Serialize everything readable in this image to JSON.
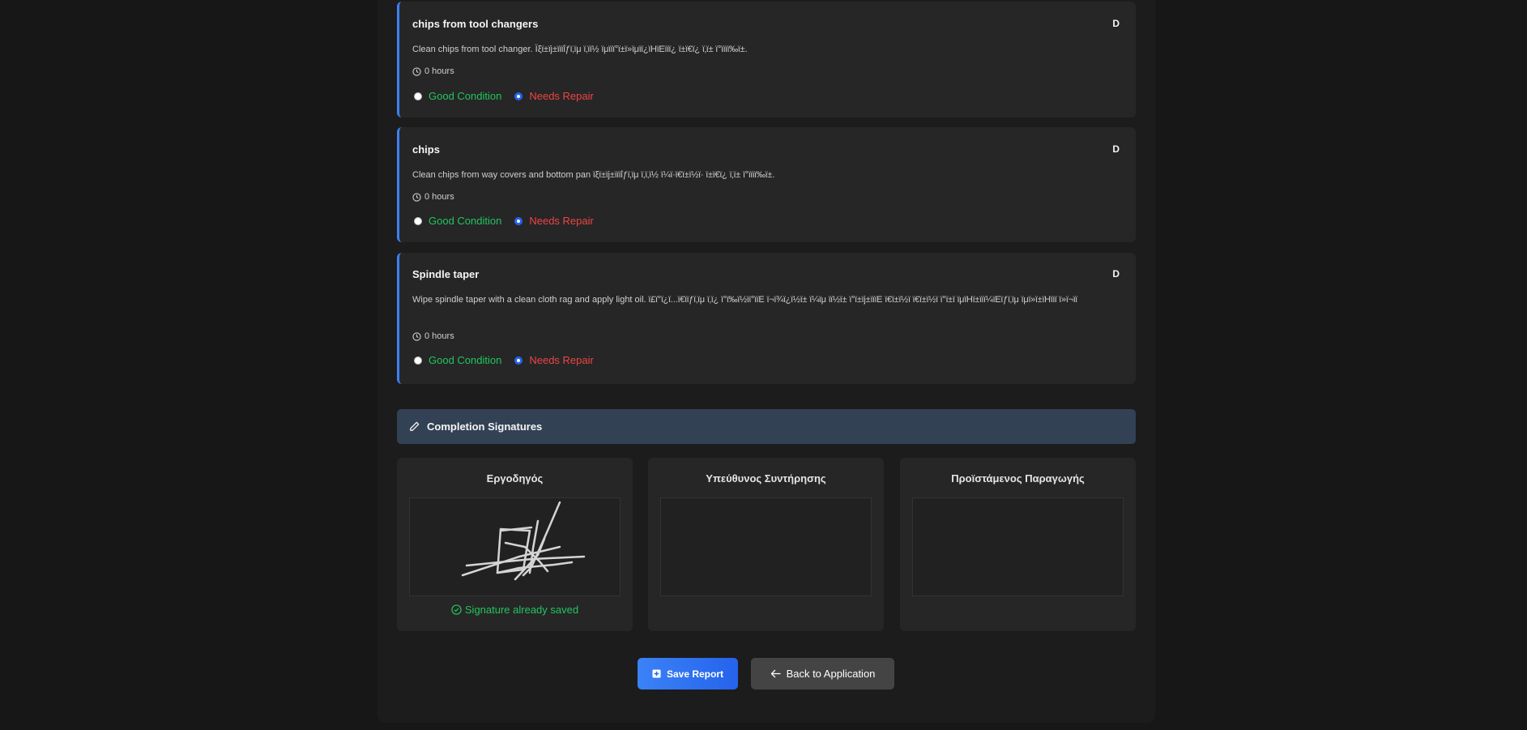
{
  "tasks": [
    {
      "title": "chips from tool changers",
      "code": "D",
      "description": "Clean chips from tool changer. Ϊξϊ±ϊϳ±ϊϊϊΐƒϊ‚ϊμ ϊ‚ϊϊ½ ϊμϊϊϊ°ϊ±ϊ»ϊμϊϊ¿ϊΗϊΕϊϊϊ¿ ϊ±ϊ€ϊ¿ ϊ‚ϊ± ϊ°ϊϊϊϊ‰ϊ±.",
      "hours": "0 hours",
      "good_label": "Good Condition",
      "repair_label": "Needs Repair",
      "selected": "repair"
    },
    {
      "title": "chips",
      "code": "D",
      "description": "Clean chips from way covers and bottom pan ϊξϊ±ϊϳ±ϊϊϊΐƒϊ‚ϊμ ϊ‚ϊ‚ϊ½ ϊ¼ϊ·ϊ€ϊ±ϊ½ϊ· ϊ±ϊ€ϊ¿ ϊ‚ϊ± ϊ°ϊϊϊϊ‰ϊ±.",
      "hours": "0 hours",
      "good_label": "Good Condition",
      "repair_label": "Needs Repair",
      "selected": "repair"
    },
    {
      "title": "Spindle taper",
      "code": "D",
      "description": "Wipe spindle taper with a clean cloth rag and apply light oil. ϊ£ϊ°ϊ¿ϊ...ϊ€ϊϊƒϊ‚ϊμ ϊ‚ϊ¿ ϊ°ϊ‰ϊ½ϊϊ°ϊϊΕ ϊ¬ϊ¾ϊ¿ϊ½ϊ± ϊ¼ϊμ ϊϊ½ϊ± ϊ°ϊ±ϊϳ±ϊϊϊΕ ϊ€ϊ±ϊ½ϊ ϊ€ϊ±ϊ½ϊ ϊ°ϊ±ϊ ϊμϊΗϊ±ϊϊϊ¼ϊΕϊƒϊ‚ϊμ ϊμϊ»ϊ±ϊΗϊϊϊ ϊ»ϊ¬ϊϊ",
      "hours": "0 hours",
      "good_label": "Good Condition",
      "repair_label": "Needs Repair",
      "selected": "repair"
    }
  ],
  "signatures": {
    "header": "Completion Signatures",
    "boxes": [
      {
        "role": "Εργοδηγός",
        "status": "Signature already saved",
        "signed": true
      },
      {
        "role": "Υπεύθυνος Συντήρησης",
        "status": "",
        "signed": false
      },
      {
        "role": "Προϊστάμενος Παραγωγής",
        "status": "",
        "signed": false
      }
    ]
  },
  "buttons": {
    "save": "Save Report",
    "back": "Back to Application"
  },
  "colors": {
    "accent": "#3b82f6",
    "good": "#22c55e",
    "repair": "#ef4444",
    "header_bg": "#334155"
  }
}
